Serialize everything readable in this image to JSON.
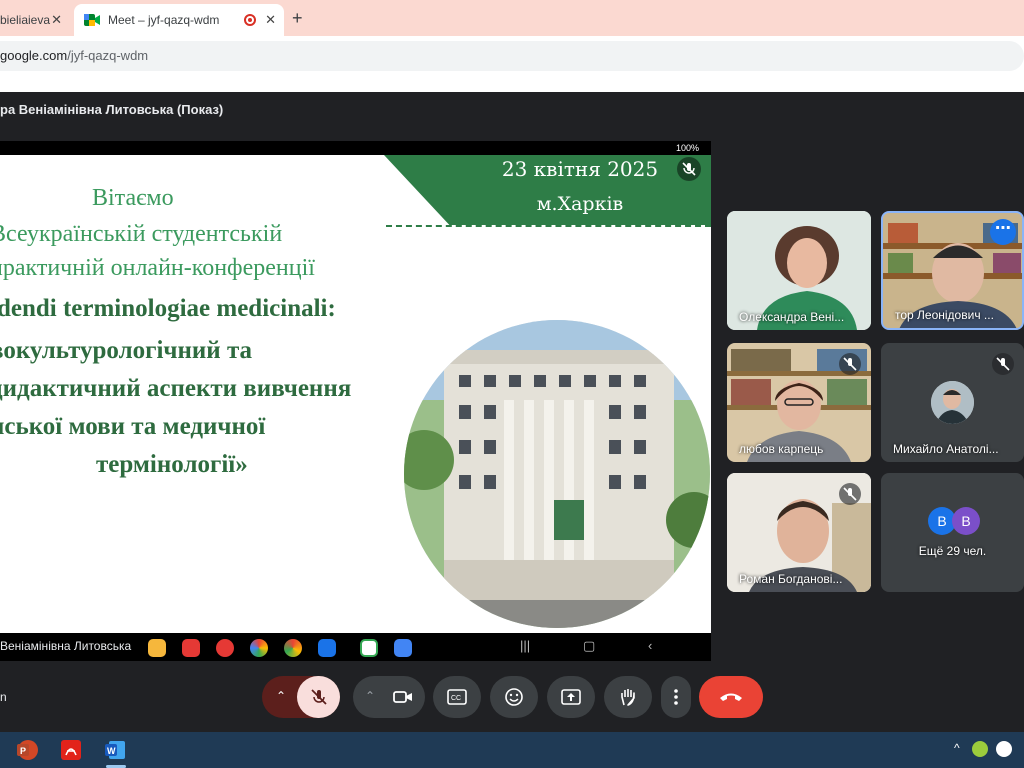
{
  "browser": {
    "tabs": [
      {
        "label": "bieliaieva",
        "active": false
      },
      {
        "label": "Meet – jyf-qazq-wdm",
        "active": true,
        "recording": true
      }
    ],
    "url_prefix": "google.com",
    "url_path": "/jyf-qazq-wdm",
    "new_tab_label": "+"
  },
  "meet": {
    "presenter_title": "ра Веніамінівна Литовська (Показ)",
    "slide": {
      "status_text": "100%",
      "date": "23 квітня 2025",
      "city": "м.Харків",
      "lines": [
        "Вітаємо",
        "Всеукраїнській студентській",
        "практичній онлайн-конференції",
        "ldendi terminologiae medicinali:",
        "вокультурологічний та",
        "дидактичний аспекти вивчення",
        "нської мови та медичної",
        "термінології»"
      ]
    },
    "android_name": "Веніамінівна Литовська",
    "participants": [
      {
        "name": "Олександра Вені...",
        "muted": false
      },
      {
        "name": "тор Леонідович ...",
        "muted": false,
        "speaking": true
      },
      {
        "name": "любов карпець",
        "muted": true
      },
      {
        "name": "Михайло Анатолі...",
        "muted": true
      },
      {
        "name": "Роман Богданові...",
        "muted": true
      },
      {
        "name": "Ещё 29 чел.",
        "avatars": [
          "В",
          "В"
        ]
      }
    ],
    "left_label": "n"
  },
  "colors": {
    "accent": "#1a73e8",
    "end_call": "#ea4335",
    "slide_green": "#2e7d47"
  }
}
